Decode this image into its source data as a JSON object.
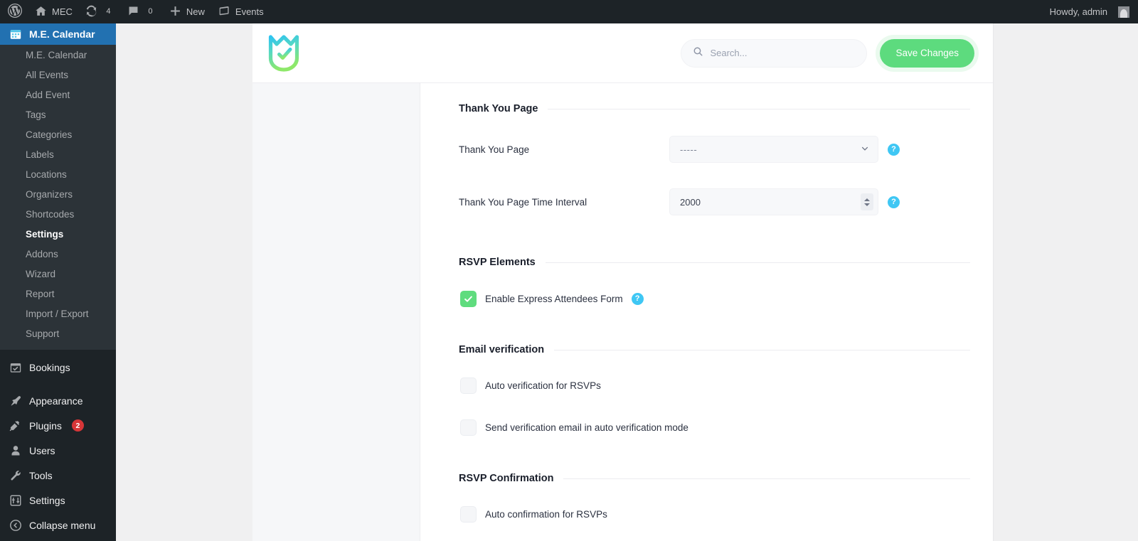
{
  "adminbar": {
    "logo_icon": "wordpress-logo-icon",
    "site_icon": "home-icon",
    "site_name": "MEC",
    "updates_icon": "updates-icon",
    "updates_count": "4",
    "comments_icon": "comment-bubble-icon",
    "comments_count": "0",
    "new_icon": "plus-icon",
    "new_label": "New",
    "events_icon": "events-icon",
    "events_label": "Events",
    "howdy": "Howdy, admin",
    "avatar_icon": "user-avatar-icon"
  },
  "sidebar": {
    "top": {
      "icon": "calendar-icon",
      "label": "M.E. Calendar"
    },
    "submenu": [
      {
        "label": "M.E. Calendar",
        "current": false
      },
      {
        "label": "All Events",
        "current": false
      },
      {
        "label": "Add Event",
        "current": false
      },
      {
        "label": "Tags",
        "current": false
      },
      {
        "label": "Categories",
        "current": false
      },
      {
        "label": "Labels",
        "current": false
      },
      {
        "label": "Locations",
        "current": false
      },
      {
        "label": "Organizers",
        "current": false
      },
      {
        "label": "Shortcodes",
        "current": false
      },
      {
        "label": "Settings",
        "current": true
      },
      {
        "label": "Addons",
        "current": false
      },
      {
        "label": "Wizard",
        "current": false
      },
      {
        "label": "Report",
        "current": false
      },
      {
        "label": "Import / Export",
        "current": false
      },
      {
        "label": "Support",
        "current": false
      }
    ],
    "bookings": {
      "icon": "bookings-calendar-icon",
      "label": "Bookings"
    },
    "core": [
      {
        "icon": "appearance-brush-icon",
        "label": "Appearance",
        "badge": ""
      },
      {
        "icon": "plugins-plug-icon",
        "label": "Plugins",
        "badge": "2"
      },
      {
        "icon": "users-icon",
        "label": "Users",
        "badge": ""
      },
      {
        "icon": "tools-wrench-icon",
        "label": "Tools",
        "badge": ""
      },
      {
        "icon": "settings-sliders-icon",
        "label": "Settings",
        "badge": ""
      },
      {
        "icon": "collapse-arrow-icon",
        "label": "Collapse menu",
        "badge": ""
      }
    ]
  },
  "header": {
    "logo_icon": "mec-shield-check-logo",
    "search_icon": "search-icon",
    "search_value": "",
    "search_placeholder": "Search...",
    "save_label": "Save Changes"
  },
  "settings": {
    "thank_you": {
      "title": "Thank You Page",
      "page_label": "Thank You Page",
      "page_value": "-----",
      "page_help": "?",
      "interval_label": "Thank You Page Time Interval",
      "interval_value": "2000",
      "interval_help": "?"
    },
    "rsvp_elements": {
      "title": "RSVP Elements",
      "express_label": "Enable Express Attendees Form",
      "express_checked": true,
      "express_help": "?"
    },
    "email_verification": {
      "title": "Email verification",
      "items": [
        {
          "label": "Auto verification for RSVPs",
          "checked": false
        },
        {
          "label": "Send verification email in auto verification mode",
          "checked": false
        }
      ]
    },
    "rsvp_confirmation": {
      "title": "RSVP Confirmation",
      "items": [
        {
          "label": "Auto confirmation for RSVPs",
          "checked": false
        }
      ]
    }
  },
  "colors": {
    "accent_green": "#5ddb7e",
    "help_blue": "#3fc7f4",
    "admin_dark": "#1d2327",
    "admin_current": "#2271b1",
    "badge_red": "#d63638"
  }
}
